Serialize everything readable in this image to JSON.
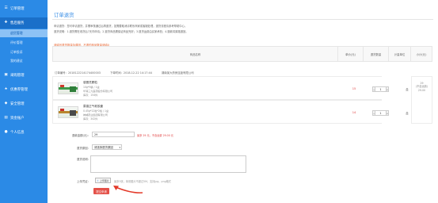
{
  "sidebar": {
    "items": [
      {
        "icon": "receipt-icon",
        "label": "订单管理"
      },
      {
        "icon": "gift-icon",
        "label": "售后服务"
      },
      {
        "icon": "box-icon",
        "label": "采购管理"
      },
      {
        "icon": "star-icon",
        "label": "优惠券管理"
      },
      {
        "icon": "shield-icon",
        "label": "安全管理"
      },
      {
        "icon": "wallet-icon",
        "label": "资金账户"
      },
      {
        "icon": "user-icon",
        "label": "个人信息"
      }
    ],
    "sub_items": [
      {
        "label": "退货管理"
      },
      {
        "label": "评价管理"
      },
      {
        "label": "订单投诉"
      },
      {
        "label": "我的建议"
      }
    ]
  },
  "page": {
    "title": "订单退货",
    "intro_1": "申请退货：您可申请退货，并需审核通过后再退货，如需要取消请联系商家或客服处理，退货流程请参考帮助中心。",
    "intro_2": "退货说明：1.退货需在收货后7天内申请；2.退货商品需保证商品完好；3.退货运费由买家承担；4.退款将原路退回。",
    "hint": "请填写退货数量及原因，不退的商品数量请填0"
  },
  "table": {
    "headers": [
      "商品名称",
      "单价(元)",
      "退货数量",
      "计量单位",
      "小计(元)"
    ]
  },
  "order": {
    "number_label": "订单编号：",
    "number": "2018122214174400003",
    "time_label": "下单时间：",
    "time": "2018-12-22 14:17:44",
    "shop": "湖南某大药房连锁有限公司"
  },
  "products": [
    {
      "name": "感冒灵颗粒",
      "spec": "10g*9袋 / 1盒",
      "maker": "华润三九医药股份有限公司",
      "stock": "库存：154件",
      "price": "15",
      "qty": "1",
      "unit": "盒"
    },
    {
      "name": "藿香正气软胶囊",
      "spec": "0.45g*12粒*2板 / 1盒",
      "maker": "神威药业集团有限公司",
      "stock": "库存：342件",
      "price": "14",
      "qty": "1",
      "unit": "盒"
    }
  ],
  "subtotal": {
    "line_1": "29",
    "line_2": "(不含运费)",
    "line_3": "29.00"
  },
  "form": {
    "amount_label": "退款金额(元)：",
    "amount_value": "29",
    "amount_note": "最多 29 元，不含运费 29.00 元",
    "reason_label": "退货原因：",
    "reason_value": "请选择退货原因",
    "desc_label": "退货说明：",
    "desc_placeholder": "",
    "upload_label": "上传凭证：",
    "upload_button": "上传图片",
    "upload_note": "最多3张，单张图片不超过5M，支持jpg、png格式",
    "submit": "提交申请"
  },
  "colors": {
    "sidebar": "#2b8ae6",
    "accent": "#3a8ee6",
    "price": "#e04040",
    "submit": "#e45149"
  }
}
